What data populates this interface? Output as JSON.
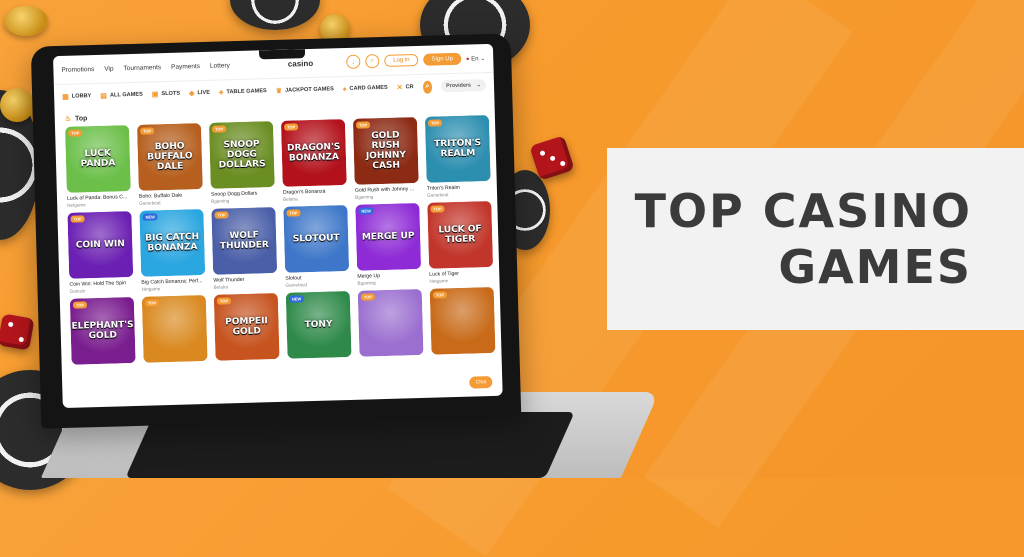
{
  "headline": {
    "line1": "TOP CASINO",
    "line2": "GAMES"
  },
  "site": {
    "nav": [
      "Promotions",
      "Vip",
      "Tournaments",
      "Payments",
      "Lottery"
    ],
    "logo": "casino",
    "login_label": "Log in",
    "signup_label": "Sign Up",
    "language": "En",
    "download_icon": "download-icon",
    "search_icon": "search-icon"
  },
  "categories": [
    {
      "label": "LOBBY",
      "icon": "lobby-icon"
    },
    {
      "label": "ALL GAMES",
      "icon": "cards-icon"
    },
    {
      "label": "SLOTS",
      "icon": "slot-icon"
    },
    {
      "label": "LIVE",
      "icon": "live-icon"
    },
    {
      "label": "TABLE GAMES",
      "icon": "table-icon"
    },
    {
      "label": "JACKPOT GAMES",
      "icon": "jackpot-icon"
    },
    {
      "label": "CARD GAMES",
      "icon": "card-icon"
    },
    {
      "label": "CR",
      "icon": "crash-icon"
    }
  ],
  "providers_placeholder": "Providers",
  "section_title": "Top",
  "chat_label": "Chat",
  "games": [
    {
      "art": "LUCK PANDA",
      "name": "Luck of Panda: Bonus C...",
      "provider": "Netgame",
      "tag": "TOP",
      "bg": "#6cc04a"
    },
    {
      "art": "BOHO BUFFALO DALE",
      "name": "Boho: Buffalo Dale",
      "provider": "Gamebeat",
      "tag": "TOP",
      "bg": "#b65f1e"
    },
    {
      "art": "SNOOP DOGG DOLLARS",
      "name": "Snoop Dogg Dollars",
      "provider": "Bgaming",
      "tag": "TOP",
      "bg": "#6b8e23"
    },
    {
      "art": "DRAGON'S BONANZA",
      "name": "Dragon's Bonanza",
      "provider": "Belatra",
      "tag": "TOP",
      "bg": "#b3121c"
    },
    {
      "art": "GOLD RUSH JOHNNY CASH",
      "name": "Gold Rush with Johnny ...",
      "provider": "Bgaming",
      "tag": "TOP",
      "bg": "#8c2a14"
    },
    {
      "art": "TRITON'S REALM",
      "name": "Triton's Realm",
      "provider": "Gamebeat",
      "tag": "TOP",
      "bg": "#2d8fb0"
    },
    {
      "art": "COIN WIN",
      "name": "Coin Win: Hold The Spin",
      "provider": "Gamzix",
      "tag": "TOP",
      "bg": "#6b1fb3"
    },
    {
      "art": "BIG CATCH BONANZA",
      "name": "Big Catch Bonanza: Perf...",
      "provider": "Netgame",
      "tag": "NEW",
      "bg": "#2aa6e0"
    },
    {
      "art": "WOLF THUNDER",
      "name": "Wolf Thunder",
      "provider": "Belatra",
      "tag": "TOP",
      "bg": "#4a5fa8"
    },
    {
      "art": "SLOTOUT",
      "name": "Slotout",
      "provider": "Gamebeat",
      "tag": "TOP",
      "bg": "#3e77c9"
    },
    {
      "art": "MERGE UP",
      "name": "Merge Up",
      "provider": "Bgaming",
      "tag": "NEW",
      "bg": "#8e2bd6"
    },
    {
      "art": "LUCK OF TIGER",
      "name": "Luck of Tiger",
      "provider": "Netgame",
      "tag": "TOP",
      "bg": "#c2352a"
    },
    {
      "art": "ELEPHANT'S GOLD",
      "name": "",
      "provider": "",
      "tag": "TOP",
      "bg": "#7a1d8f"
    },
    {
      "art": "",
      "name": "",
      "provider": "",
      "tag": "TOP",
      "bg": "#d9891f"
    },
    {
      "art": "POMPEII GOLD",
      "name": "",
      "provider": "",
      "tag": "TOP",
      "bg": "#c7531f"
    },
    {
      "art": "TONY",
      "name": "",
      "provider": "",
      "tag": "NEW",
      "bg": "#2f8a4a"
    },
    {
      "art": "",
      "name": "",
      "provider": "",
      "tag": "TOP",
      "bg": "#9b6fd0"
    },
    {
      "art": "",
      "name": "",
      "provider": "",
      "tag": "TOP",
      "bg": "#c86a18"
    }
  ]
}
